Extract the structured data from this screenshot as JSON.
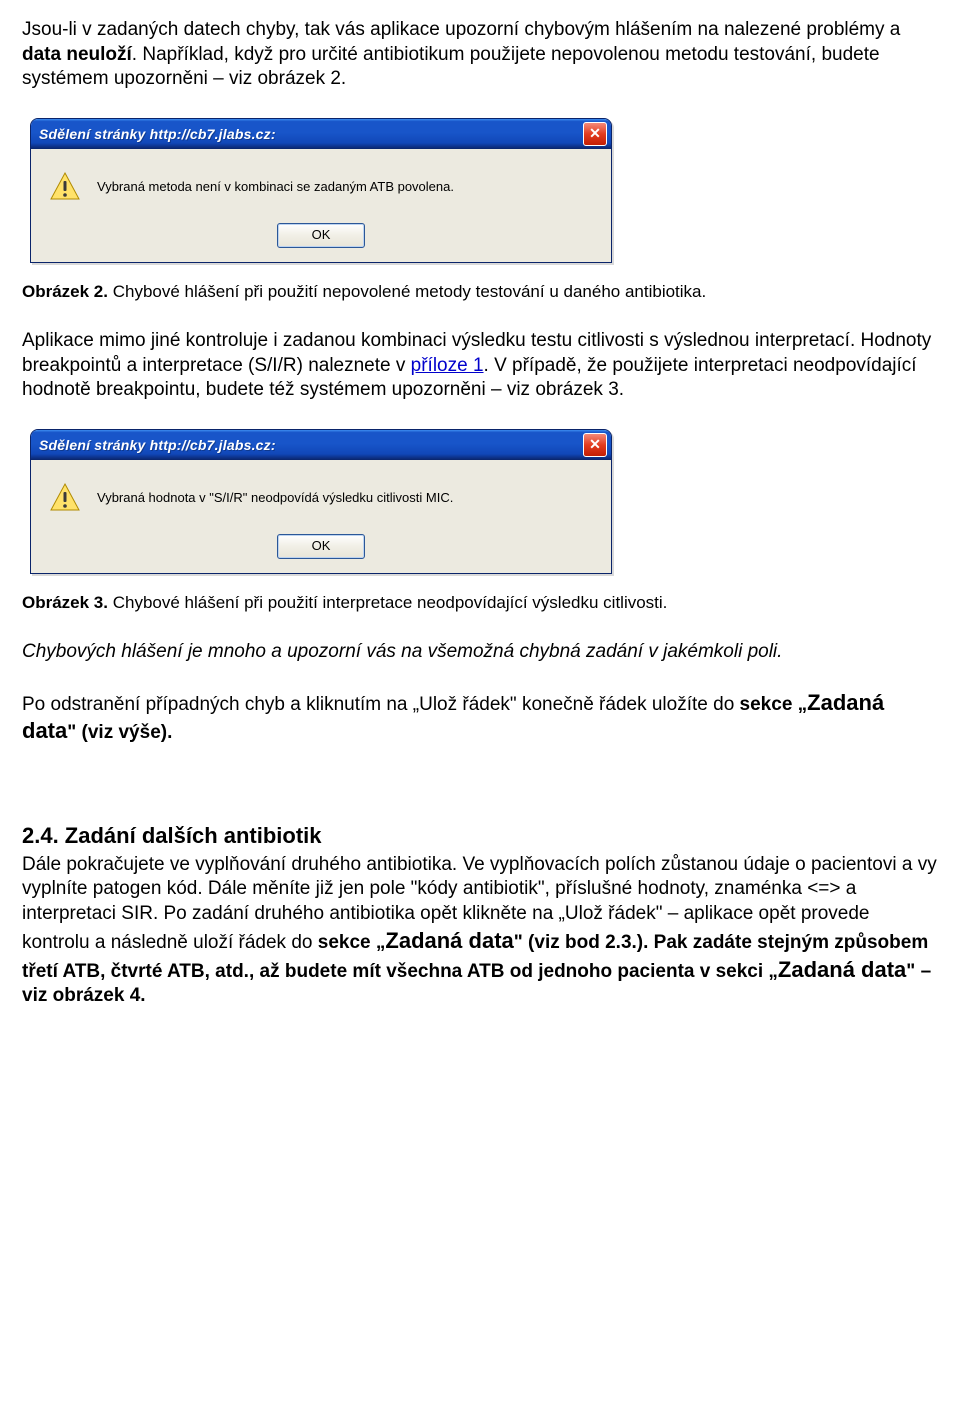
{
  "p1_a": "Jsou-li v zadaných datech chyby, tak vás aplikace upozorní chybovým hlášením na nalezené problémy a ",
  "p1_b": "data neuloží",
  "p1_c": ". Například, když pro určité antibiotikum použijete nepovolenou metodu testování, budete systémem upozorněni – viz obrázek 2.",
  "dialog1": {
    "title": "Sdělení stránky http://cb7.jlabs.cz:",
    "message": "Vybraná metoda není v kombinaci se zadaným ATB povolena.",
    "ok": "OK",
    "close": "✕",
    "icon": "warning-icon"
  },
  "caption1_a": "Obrázek 2.",
  "caption1_b": " Chybové hlášení při použití nepovolené metody testování u daného antibiotika.",
  "p2_a": "Aplikace mimo jiné kontroluje i zadanou kombinaci výsledku testu citlivosti s výslednou interpretací. Hodnoty breakpointů a interpretace (S/I/R) naleznete v ",
  "p2_link": "příloze 1",
  "p2_b": ". V případě, že použijete interpretaci neodpovídající hodnotě breakpointu, budete též systémem upozorněni – viz obrázek 3.",
  "dialog2": {
    "title": "Sdělení stránky http://cb7.jlabs.cz:",
    "message": "Vybraná hodnota v \"S/I/R\" neodpovídá výsledku citlivosti MIC.",
    "ok": "OK",
    "close": "✕",
    "icon": "warning-icon"
  },
  "caption2_a": "Obrázek 3.",
  "caption2_b": " Chybové hlášení při použití interpretace neodpovídající výsledku citlivosti.",
  "p3": "Chybových hlášení je mnoho a upozorní vás na všemožná chybná zadání v jakémkoli poli.",
  "p4_a": "Po odstranění případných chyb a kliknutím na „Ulož řádek\" konečně řádek uložíte do ",
  "p4_b": "sekce „",
  "p4_c": "Zadaná data",
  "p4_d": "\" (viz výše).",
  "h2": "2.4. Zadání dalších antibiotik",
  "p5_a": "Dále pokračujete ve vyplňování druhého antibiotika. Ve vyplňovacích polích zůstanou údaje o pacientovi a vy vyplníte patogen kód. Dále měníte již jen pole \"kódy antibiotik\", příslušné hodnoty, znaménka <=> a interpretaci SIR. Po zadání druhého antibiotika opět klikněte na „Ulož řádek\" – aplikace opět provede kontrolu a následně uloží řádek do ",
  "p5_b": "sekce „",
  "p5_c": "Zadaná data",
  "p5_d": "\" (viz bod 2.3.). Pak zadáte stejným způsobem třetí ATB, čtvrté ATB, atd., až budete mít všechna ATB od jednoho pacienta v sekci „",
  "p5_e": "Zadaná data",
  "p5_f": "\" – viz obrázek 4."
}
